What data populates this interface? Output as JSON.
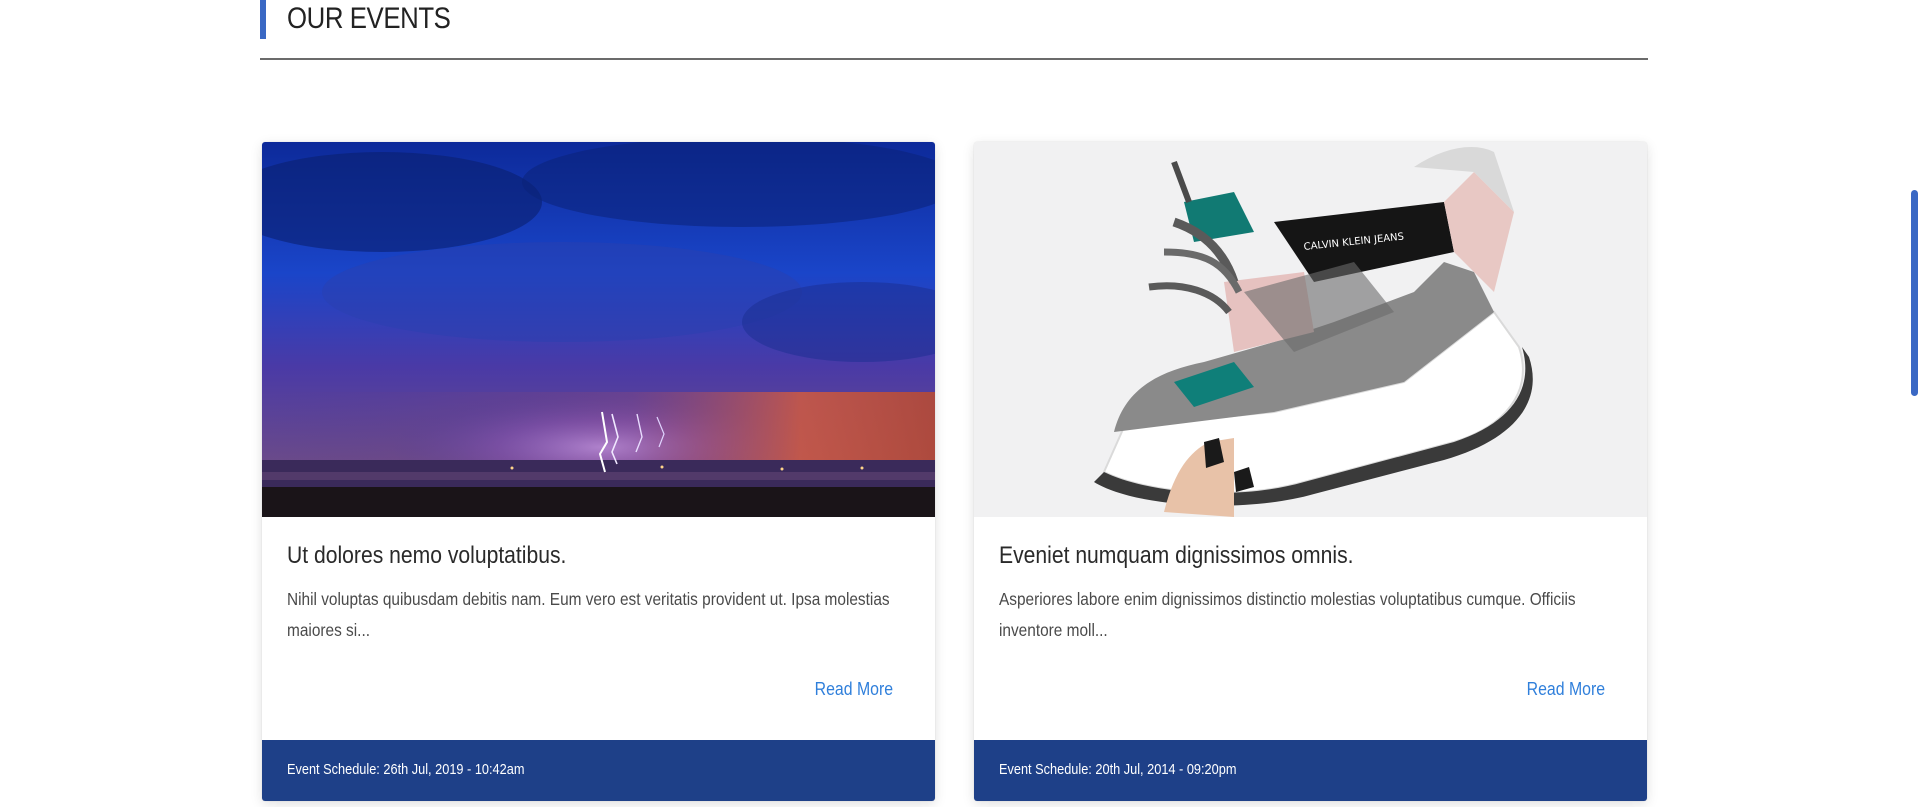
{
  "section": {
    "title": "OUR EVENTS"
  },
  "events": [
    {
      "image_subject": "lightning storm over sea at dusk",
      "title": "Ut dolores nemo voluptatibus.",
      "excerpt": "Nihil voluptas quibusdam debitis nam. Eum vero est veritatis provident ut. Ipsa molestias maiores si...",
      "read_more": "Read More",
      "schedule": "Event Schedule: 26th Jul, 2019 - 10:42am"
    },
    {
      "image_subject": "hand holding a chunky sneaker",
      "image_text": "CALVIN KLEIN JEANS",
      "title": "Eveniet numquam dignissimos omnis.",
      "excerpt": "Asperiores labore enim dignissimos distinctio molestias voluptatibus cumque. Officiis inventore moll...",
      "read_more": "Read More",
      "schedule": "Event Schedule: 20th Jul, 2014 - 09:20pm"
    }
  ],
  "colors": {
    "accent": "#3a68c4",
    "footer": "#1e4088",
    "link": "#2f7fdb"
  }
}
